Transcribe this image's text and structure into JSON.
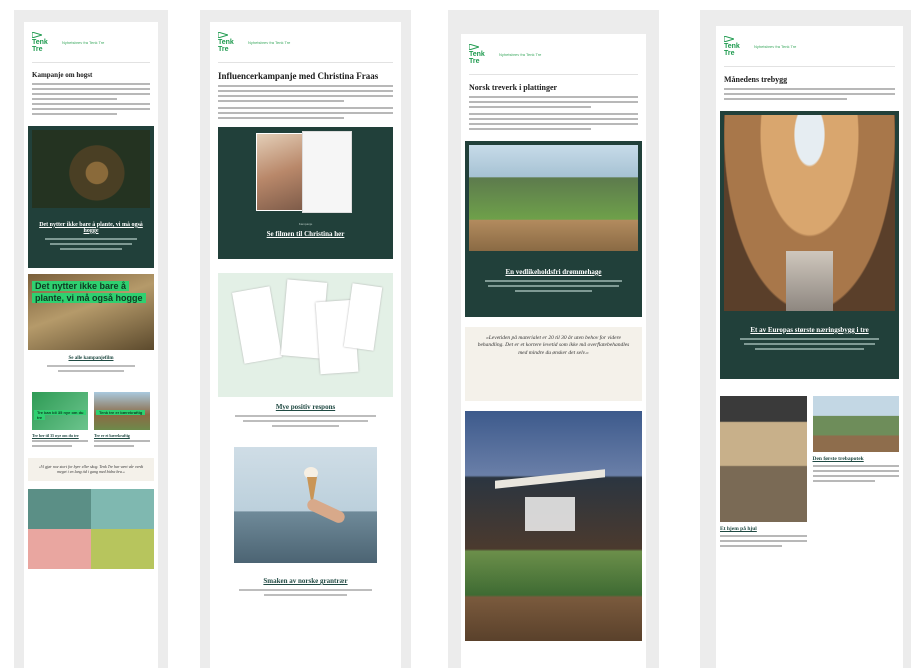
{
  "brand": {
    "logo_text": "Tenk Tre",
    "tagline": "Nyhetsbrev fra Tenk Tre",
    "accent": "#1e9a4e"
  },
  "newsletters": [
    {
      "title": "Kampanje om hogst",
      "hero_title": "Det nytter ikke bare å plante, vi må også hogge",
      "poster_text": "Det nytter ikke bare å plante, vi må også hogge",
      "link_title": "Se alle kampanjefilm",
      "item_left": "Tre ber til 35 nye om du tre",
      "item_right": "Tre er et bærekraftig",
      "tile_left": "Tre kan bli 35 nye om du tre",
      "tile_right": "Tenk tre er bærekraftig",
      "quote": "«Vi gjør noe stort for byer eller skog. Tenk Tre har vært vår verdt meget i en lang tid i gang med bidra bra.»"
    },
    {
      "title": "Influencerkampanje med Christina Fraas",
      "video_title": "Se filmen til Christina her",
      "section_title": "Mye positiv respons",
      "small_label": "Kampanje",
      "product_title": "Smaken av norske grantrær"
    },
    {
      "title": "Norsk treverk i plattinger",
      "card_title": "En vedlikeholdsfri drømmehage",
      "quote": "«Levetiden på materialet er 20 til 30 år uten behov for videre behandling. Det er et kortere levetid som ikke må overflatebehandles med mindre du ønsker det selv.»"
    },
    {
      "title": "Månedens trebygg",
      "hero_title": "Et av Europas største næringsbygg i tre",
      "left_title": "Et hjem på hjul",
      "right_title": "Den første trebapotek"
    }
  ]
}
